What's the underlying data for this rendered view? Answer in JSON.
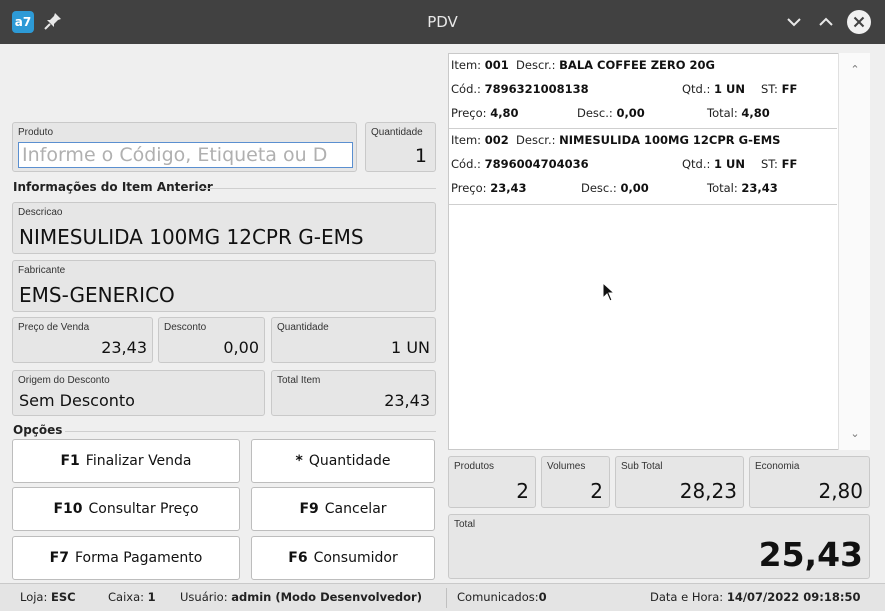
{
  "window": {
    "title": "PDV",
    "app_icon": "a7",
    "colors": {
      "titlebar": "#414141",
      "accent": "#5a8fd0"
    }
  },
  "icons": {
    "app": "app-logo-icon",
    "pin": "pin-icon",
    "minimize": "chevron-down-icon",
    "maximize": "chevron-up-icon",
    "close": "close-icon"
  },
  "produto": {
    "label": "Produto",
    "placeholder": "Informe o Código, Etiqueta ou D"
  },
  "quantidade": {
    "label": "Quantidade",
    "value": "1"
  },
  "anterior": {
    "section_title": "Informações do Item Anterior",
    "descricao_label": "Descricao",
    "descricao": "NIMESULIDA 100MG 12CPR G-EMS",
    "fabricante_label": "Fabricante",
    "fabricante": "EMS-GENERICO",
    "preco_label": "Preço de Venda",
    "preco": "23,43",
    "desconto_label": "Desconto",
    "desconto": "0,00",
    "quantidade_label": "Quantidade",
    "quantidade": "1 UN",
    "origem_label": "Origem do Desconto",
    "origem": "Sem Desconto",
    "total_label": "Total Item",
    "total": "23,43"
  },
  "opcoes": {
    "section_title": "Opções",
    "buttons": [
      {
        "key": "F1",
        "label": "Finalizar Venda"
      },
      {
        "key": "*",
        "label": "Quantidade"
      },
      {
        "key": "F10",
        "label": "Consultar Preço"
      },
      {
        "key": "F9",
        "label": "Cancelar"
      },
      {
        "key": "F7",
        "label": "Forma Pagamento"
      },
      {
        "key": "F6",
        "label": "Consumidor"
      }
    ]
  },
  "items_labels": {
    "item": "Item:",
    "descr": "Descr.:",
    "cod": "Cód.:",
    "qtd": "Qtd.:",
    "st": "ST:",
    "preco": "Preço:",
    "desc": "Desc.:",
    "total": "Total:"
  },
  "items": [
    {
      "num": "001",
      "descr": "BALA COFFEE ZERO 20G",
      "cod": "7896321008138",
      "qtd": "1 UN",
      "st": "FF",
      "preco": "4,80",
      "desc": "0,00",
      "total": "4,80"
    },
    {
      "num": "002",
      "descr": "NIMESULIDA 100MG 12CPR G-EMS",
      "cod": "7896004704036",
      "qtd": "1 UN",
      "st": "FF",
      "preco": "23,43",
      "desc": "0,00",
      "total": "23,43"
    }
  ],
  "totais": {
    "produtos_label": "Produtos",
    "produtos": "2",
    "volumes_label": "Volumes",
    "volumes": "2",
    "subtotal_label": "Sub Total",
    "subtotal": "28,23",
    "economia_label": "Economia",
    "economia": "2,80",
    "total_label": "Total",
    "total": "25,43"
  },
  "status": {
    "loja_label": "Loja:",
    "loja": "ESC",
    "caixa_label": "Caixa:",
    "caixa": "1",
    "usuario_label": "Usuário:",
    "usuario": "admin (Modo Desenvolvedor)",
    "comunicados_label": "Comunicados:",
    "comunicados": "0",
    "datahora_label": "Data e Hora:",
    "datahora": "14/07/2022 09:18:50"
  }
}
